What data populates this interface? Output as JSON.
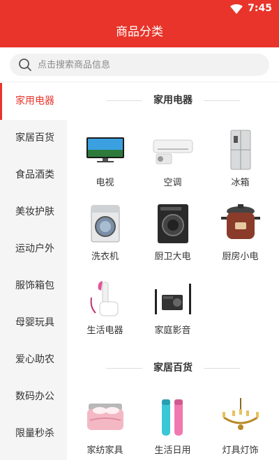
{
  "status_bar": {
    "time": "7:45",
    "icons": [
      "wifi-icon"
    ]
  },
  "header": {
    "title": "商品分类"
  },
  "search": {
    "placeholder": "点击搜索商品信息",
    "value": ""
  },
  "sidebar": {
    "items": [
      {
        "label": "家用电器",
        "active": true
      },
      {
        "label": "家居百货",
        "active": false
      },
      {
        "label": "食品酒类",
        "active": false
      },
      {
        "label": "美妆护肤",
        "active": false
      },
      {
        "label": "运动户外",
        "active": false
      },
      {
        "label": "服饰箱包",
        "active": false
      },
      {
        "label": "母婴玩具",
        "active": false
      },
      {
        "label": "爱心助农",
        "active": false
      },
      {
        "label": "数码办公",
        "active": false
      },
      {
        "label": "限量秒杀",
        "active": false
      }
    ]
  },
  "sections": [
    {
      "title": "家用电器",
      "items": [
        {
          "label": "电视",
          "icon": "tv-icon"
        },
        {
          "label": "空调",
          "icon": "air-conditioner-icon"
        },
        {
          "label": "冰箱",
          "icon": "refrigerator-icon"
        },
        {
          "label": "洗衣机",
          "icon": "washing-machine-icon"
        },
        {
          "label": "厨卫大电",
          "icon": "kitchen-appliance-icon"
        },
        {
          "label": "厨房小电",
          "icon": "pressure-cooker-icon"
        },
        {
          "label": "生活电器",
          "icon": "garment-steamer-icon"
        },
        {
          "label": "家庭影音",
          "icon": "home-theater-icon"
        }
      ]
    },
    {
      "title": "家居百货",
      "items": [
        {
          "label": "家纺家具",
          "icon": "bedding-icon"
        },
        {
          "label": "生活日用",
          "icon": "thermos-icon"
        },
        {
          "label": "灯具灯饰",
          "icon": "chandelier-icon"
        }
      ]
    }
  ],
  "colors": {
    "accent": "#e8342a",
    "sidebar_bg": "#f5f5f5"
  }
}
